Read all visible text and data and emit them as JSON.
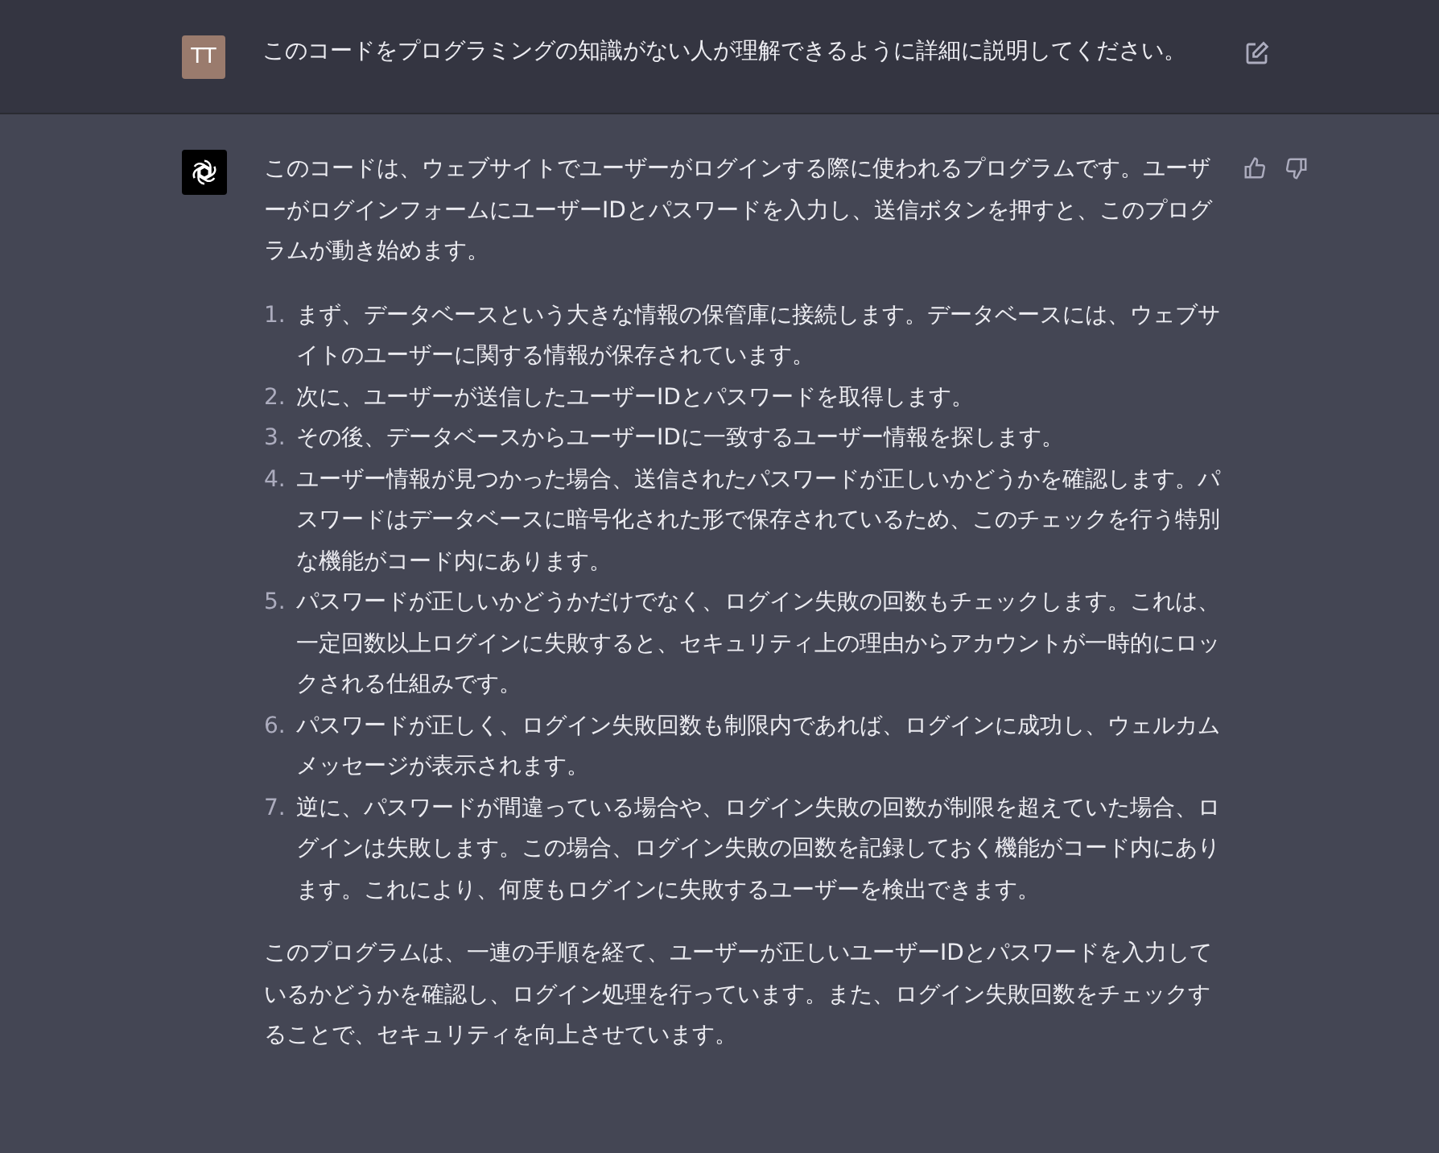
{
  "user_message": {
    "avatar": "TT",
    "text": "このコードをプログラミングの知識がない人が理解できるように詳細に説明してください。"
  },
  "assistant_message": {
    "intro": "このコードは、ウェブサイトでユーザーがログインする際に使われるプログラムです。ユーザーがログインフォームにユーザーIDとパスワードを入力し、送信ボタンを押すと、このプログラムが動き始めます。",
    "steps": [
      {
        "number": "1.",
        "text": "まず、データベースという大きな情報の保管庫に接続します。データベースには、ウェブサイトのユーザーに関する情報が保存されています。"
      },
      {
        "number": "2.",
        "text": "次に、ユーザーが送信したユーザーIDとパスワードを取得します。"
      },
      {
        "number": "3.",
        "text": "その後、データベースからユーザーIDに一致するユーザー情報を探します。"
      },
      {
        "number": "4.",
        "text": "ユーザー情報が見つかった場合、送信されたパスワードが正しいかどうかを確認します。パスワードはデータベースに暗号化された形で保存されているため、このチェックを行う特別な機能がコード内にあります。"
      },
      {
        "number": "5.",
        "text": "パスワードが正しいかどうかだけでなく、ログイン失敗の回数もチェックします。これは、一定回数以上ログインに失敗すると、セキュリティ上の理由からアカウントが一時的にロックされる仕組みです。"
      },
      {
        "number": "6.",
        "text": "パスワードが正しく、ログイン失敗回数も制限内であれば、ログインに成功し、ウェルカムメッセージが表示されます。"
      },
      {
        "number": "7.",
        "text": "逆に、パスワードが間違っている場合や、ログイン失敗の回数が制限を超えていた場合、ログインは失敗します。この場合、ログイン失敗の回数を記録しておく機能がコード内にあります。これにより、何度もログインに失敗するユーザーを検出できます。"
      }
    ],
    "conclusion": "このプログラムは、一連の手順を経て、ユーザーが正しいユーザーIDとパスワードを入力しているかどうかを確認し、ログイン処理を行っています。また、ログイン失敗回数をチェックすることで、セキュリティを向上させています。"
  }
}
